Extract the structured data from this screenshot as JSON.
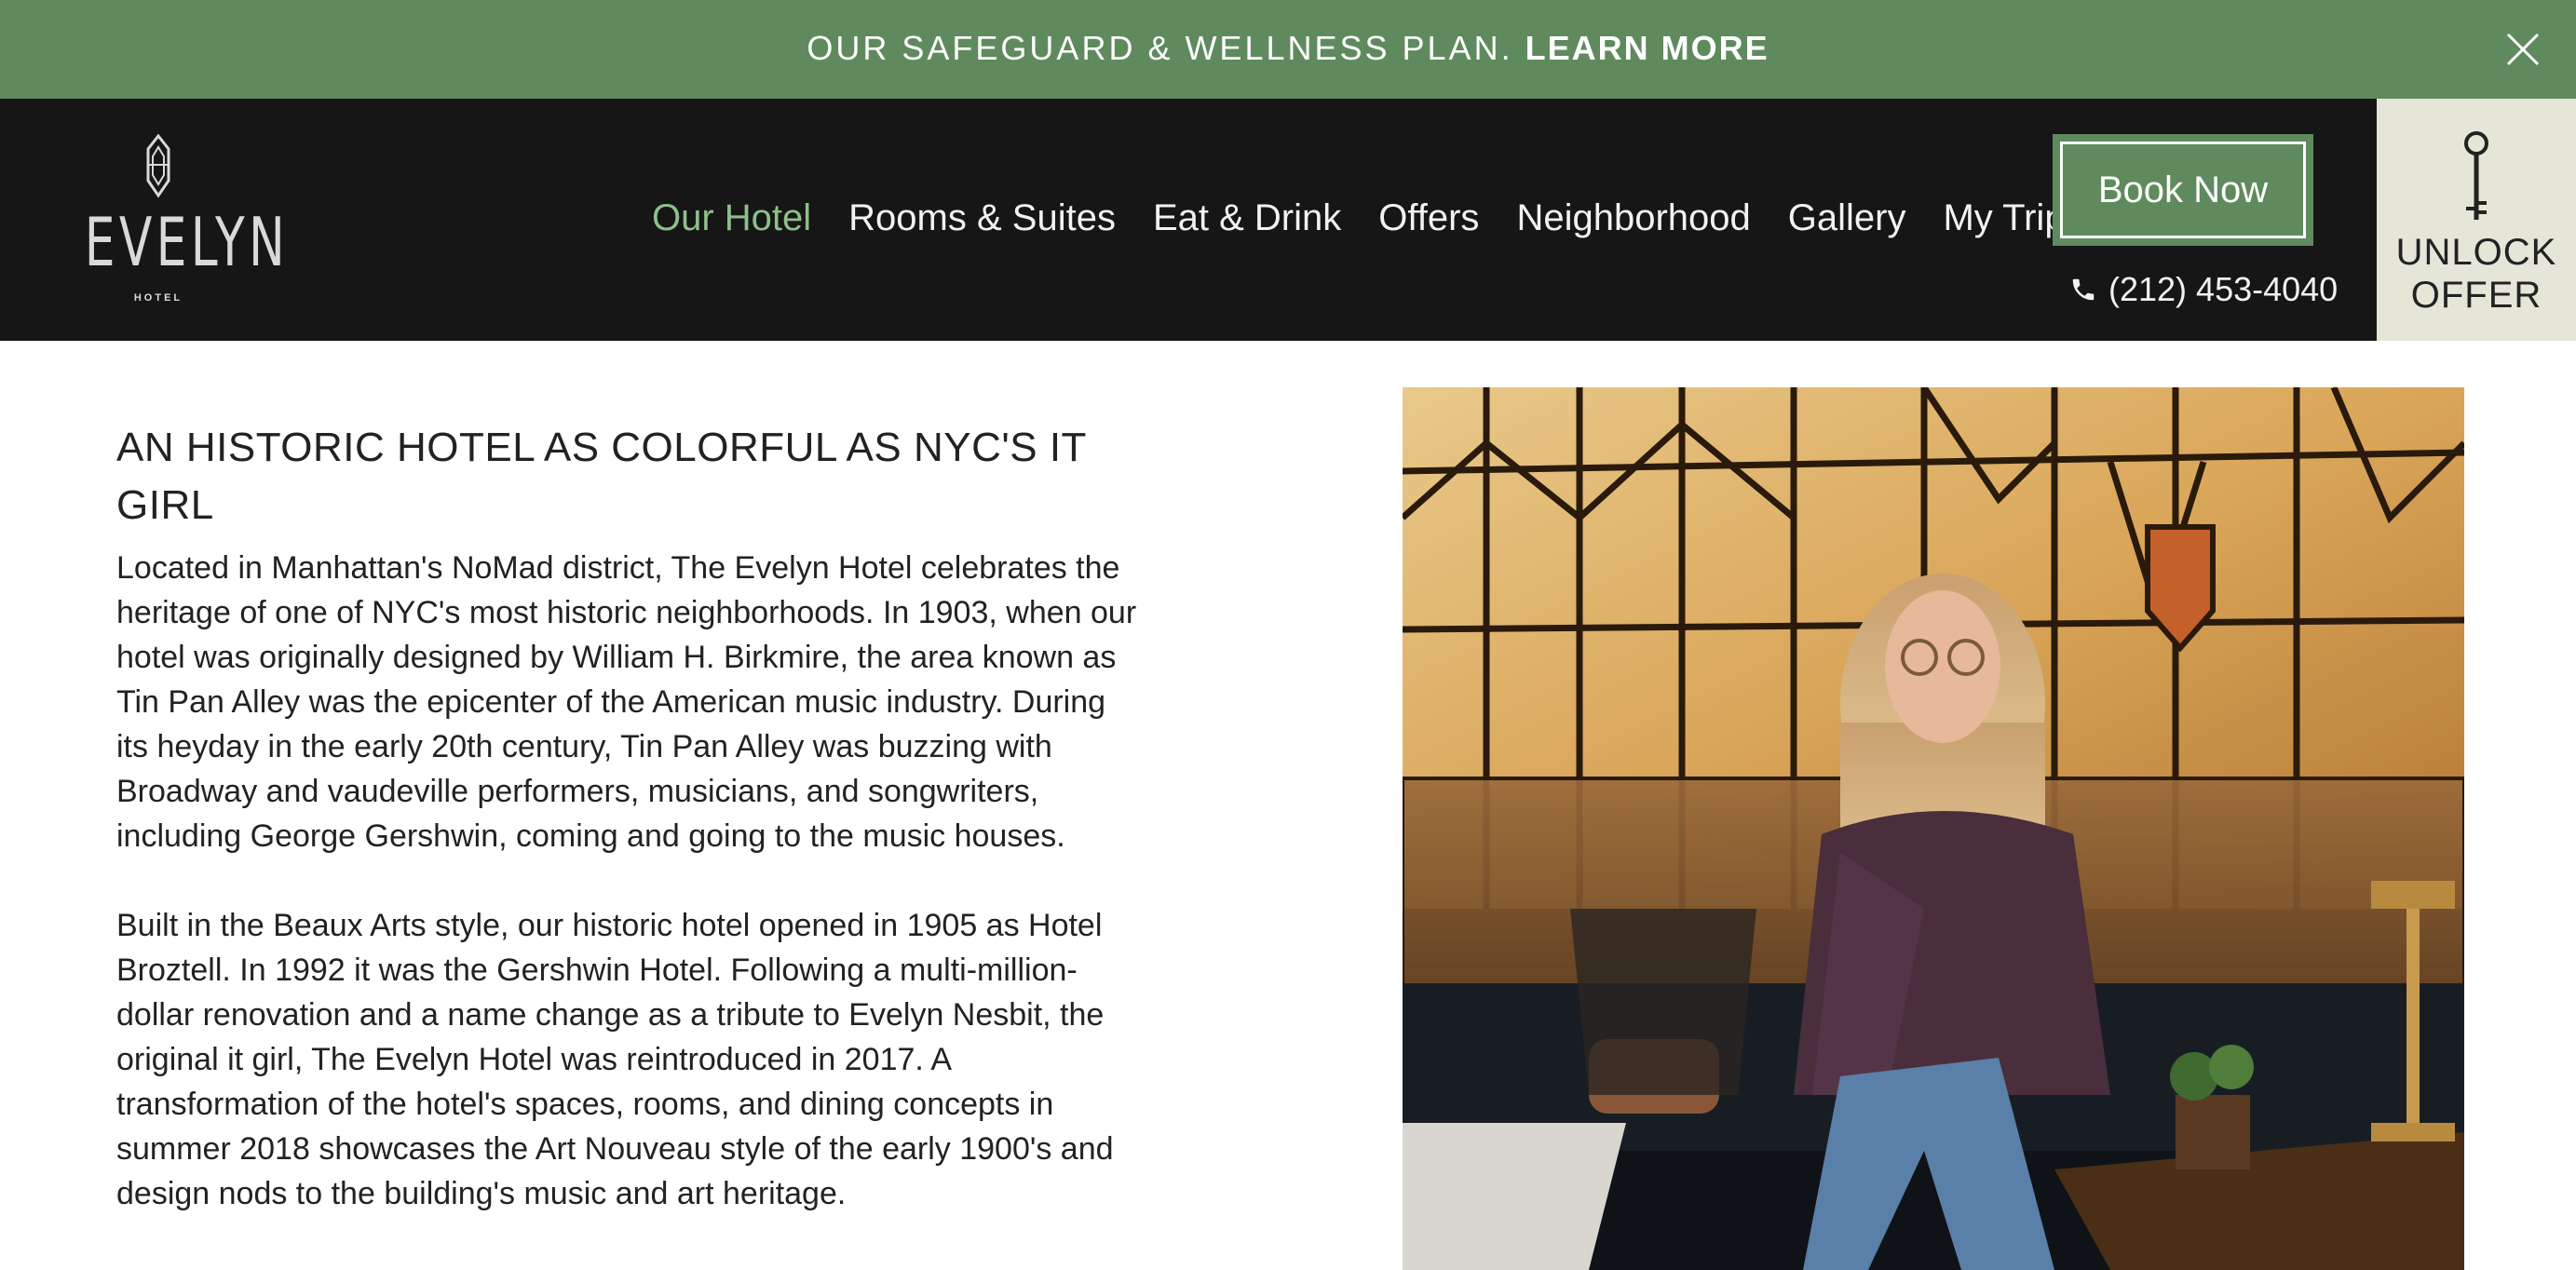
{
  "announcement": {
    "text": "OUR SAFEGUARD & WELLNESS PLAN. ",
    "link": "LEARN MORE",
    "close_icon": "close-icon"
  },
  "header": {
    "logo": {
      "name": "EVELYN",
      "sub": "HOTEL"
    },
    "nav": [
      {
        "label": "Our Hotel",
        "active": true
      },
      {
        "label": "Rooms & Suites"
      },
      {
        "label": "Eat & Drink"
      },
      {
        "label": "Offers"
      },
      {
        "label": "Neighborhood"
      },
      {
        "label": "Gallery"
      },
      {
        "label": "My Trips"
      }
    ],
    "book_label": "Book Now",
    "phone": "(212) 453-4040",
    "phone_icon": "phone-icon",
    "unlock_line1": "UNLOCK",
    "unlock_line2": "OFFER",
    "unlock_icon": "key-icon"
  },
  "main": {
    "heading": "AN HISTORIC HOTEL AS COLORFUL AS NYC'S IT GIRL",
    "paragraphs": [
      "Located in Manhattan's NoMad district, The Evelyn Hotel celebrates the heritage of one of NYC's most historic neighborhoods. In 1903, when our hotel was originally designed by William H. Birkmire, the area known as Tin Pan Alley was the epicenter of the American music industry. During its heyday in the early 20th century, Tin Pan Alley was buzzing with Broadway and vaudeville performers, musicians, and songwriters, including George Gershwin, coming and going to the music houses.",
      "Built in the Beaux Arts style, our historic hotel opened in 1905 as Hotel Broztell. In 1992 it was the Gershwin Hotel. Following a multi-million-dollar renovation and a name change as a tribute to Evelyn Nesbit, the original it girl, The Evelyn Hotel was reintroduced in 2017. A transformation of the hotel's spaces, rooms, and dining concepts in summer 2018 showcases the Art Nouveau style of the early 1900's and design nods to the building's music and art heritage."
    ]
  },
  "colors": {
    "brand_green": "#5f8a5e",
    "active_nav": "#8cc08a",
    "header_bg": "#161616",
    "unlock_bg": "#e6e6d8"
  }
}
